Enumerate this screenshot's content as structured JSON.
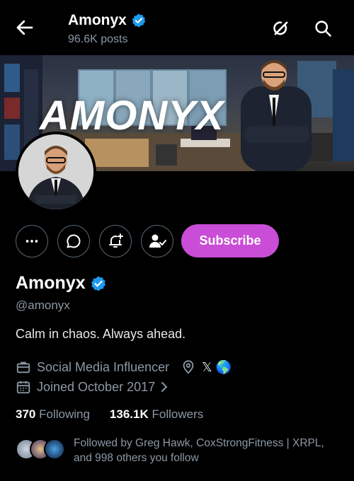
{
  "header": {
    "title": "Amonyx",
    "posts_count": "96.6K posts",
    "icons": [
      "back-arrow-icon",
      "grok-icon",
      "search-icon"
    ]
  },
  "banner": {
    "logo_text": "AMONYX"
  },
  "actions": {
    "buttons": [
      "more-icon",
      "message-icon",
      "notify-add-icon",
      "following-user-icon"
    ],
    "subscribe_label": "Subscribe"
  },
  "profile": {
    "name": "Amonyx",
    "handle": "@amonyx",
    "bio": "Calm in chaos. Always ahead.",
    "category": "Social Media Influencer",
    "location": "𝕏 🌎",
    "joined": "Joined October 2017",
    "following_count": "370",
    "following_label": "Following",
    "followers_count": "136.1K",
    "followers_label": "Followers",
    "followed_by": "Followed by Greg Hawk, CoxStrongFitness | XRPL, and 998 others you follow"
  },
  "colors": {
    "background": "#000000",
    "verified": "#1d9bf0",
    "subscribe": "#c94dd6",
    "secondary_text": "#8b98a5"
  }
}
